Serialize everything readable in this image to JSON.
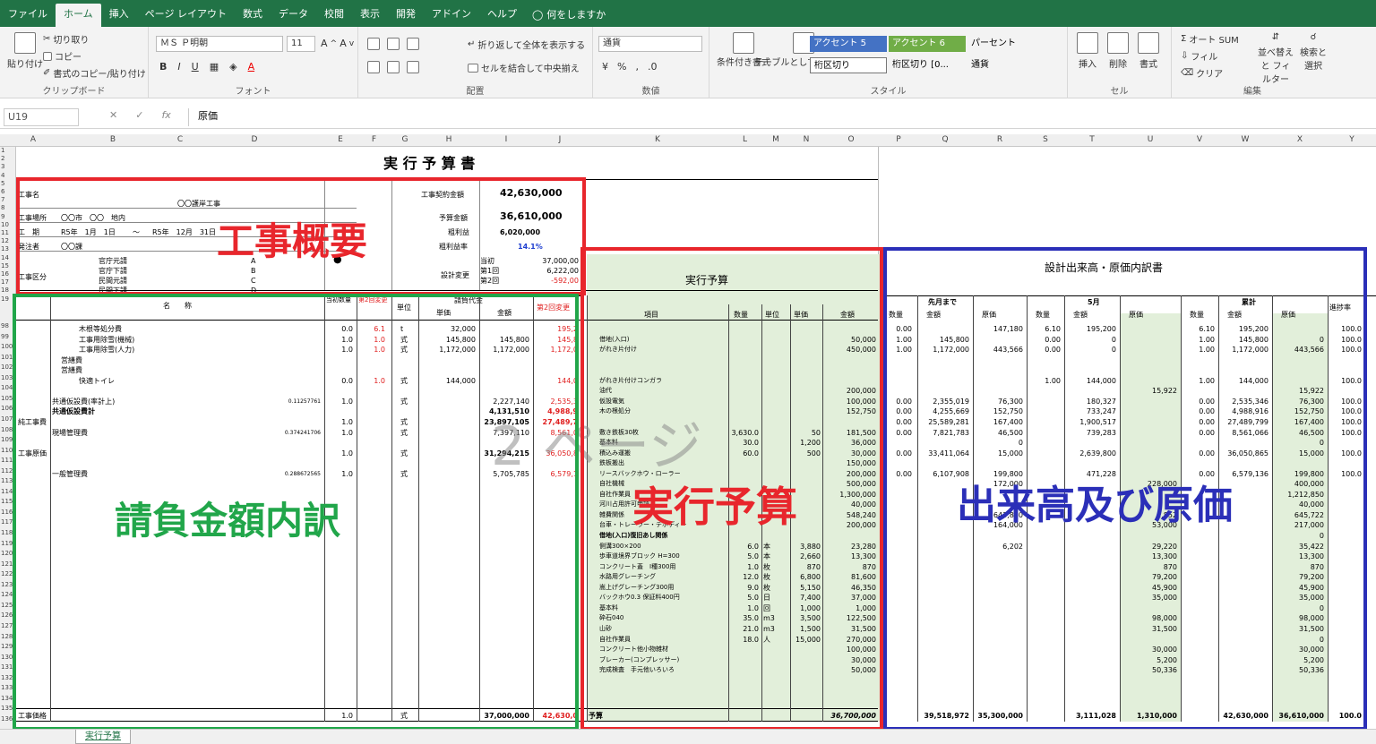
{
  "menu": {
    "file": "ファイル",
    "home": "ホーム",
    "insert": "挿入",
    "page_layout": "ページ レイアウト",
    "formulas": "数式",
    "data": "データ",
    "review": "校閲",
    "view": "表示",
    "developer": "開発",
    "addins": "アドイン",
    "help": "ヘルプ",
    "tell_me": "何をしますか"
  },
  "ribbon": {
    "paste": "貼り付け",
    "cut": "切り取り",
    "copy": "コピー",
    "format_painter": "書式のコピー/貼り付け",
    "clipboard": "クリップボード",
    "font_name": "ＭＳ Ｐ明朝",
    "font_size": "11",
    "font": "フォント",
    "wrap_text": "折り返して全体を表示する",
    "merge_center": "セルを結合して中央揃え",
    "alignment": "配置",
    "number_format": "通貨",
    "number": "数値",
    "conditional": "条件付き書式",
    "table_format": "テーブルとして書式設定",
    "accent5": "アクセント 5",
    "accent6": "アクセント 6",
    "percent": "パーセント",
    "style_sep": "桁区切り",
    "style_sep0": "桁区切り [0...",
    "style_currency": "通貨",
    "styles": "スタイル",
    "insert": "挿入",
    "delete": "削除",
    "format": "書式",
    "cells": "セル",
    "autosum": "オート SUM",
    "fill": "フィル",
    "clear": "クリア",
    "sort_filter": "並べ替えと フィルター",
    "find_select": "検索と 選択",
    "editing": "編集"
  },
  "formula_bar": {
    "cell_ref": "U19",
    "value": "原価",
    "fx": "fx"
  },
  "columns": [
    "A",
    "B",
    "C",
    "D",
    "E",
    "F",
    "G",
    "H",
    "I",
    "J",
    "K",
    "L",
    "M",
    "N",
    "O",
    "P",
    "Q",
    "R",
    "S",
    "T",
    "U",
    "V",
    "W",
    "X",
    "Y"
  ],
  "rows": [
    "1",
    "2",
    "3",
    "4",
    "5",
    "6",
    "7",
    "8",
    "9",
    "10",
    "11",
    "12",
    "13",
    "14",
    "15",
    "16",
    "17",
    "18",
    "19",
    "98",
    "99",
    "100",
    "101",
    "102",
    "103",
    "104",
    "105",
    "106",
    "107",
    "108",
    "109",
    "110",
    "111",
    "112",
    "113",
    "114",
    "115",
    "116",
    "117",
    "118",
    "119",
    "120",
    "121",
    "122",
    "123",
    "124",
    "125",
    "126",
    "127",
    "128",
    "129",
    "130",
    "131",
    "132",
    "133",
    "134",
    "135",
    "136"
  ],
  "sheet": {
    "title": "実 行 予 算 書",
    "summary": {
      "name_label": "工事名",
      "name": "〇〇護岸工事",
      "place_label": "工事場所",
      "place": "〇〇市　〇〇　地内",
      "period_label": "工　期",
      "period_start": "R5年　1月　1日",
      "period_tilde": "〜",
      "period_end": "R5年　12月　31日",
      "orderer_label": "発注者",
      "orderer": "〇〇課",
      "class_label": "工事区分",
      "class_items": [
        "官庁元請",
        "官庁下請",
        "民間元請",
        "民間下請"
      ],
      "class_codes": [
        "A",
        "B",
        "C",
        "D"
      ],
      "contract_label": "工事契約金額",
      "contract": "42,630,000",
      "budget_label": "予算金額",
      "budget": "36,610,000",
      "profit_label": "粗利益",
      "profit": "6,020,000",
      "profit_rate_label": "粗利益率",
      "profit_rate": "14.1%",
      "design_change_label": "設計変更",
      "changes": [
        {
          "label": "当初",
          "value": "37,000,00"
        },
        {
          "label": "第1回",
          "value": "6,222,00"
        },
        {
          "label": "第2回",
          "value": "-592,00"
        }
      ]
    },
    "contract_header": {
      "name": "名　　称",
      "qty": "当初数量",
      "change2": "第2回変更",
      "unit": "単位",
      "contract_price": "請負代金",
      "unit_price": "単価",
      "amount": "金額",
      "change2_amount": "第2回変更"
    },
    "contract_rows": [
      {
        "name": "木根等処分費",
        "qty": "0.0",
        "c2": "6.1",
        "unit": "t",
        "price": "32,000",
        "amount": "",
        "c2amt": "195,2"
      },
      {
        "name": "工事用除雪(機械)",
        "qty": "1.0",
        "c2": "1.0",
        "unit": "式",
        "price": "145,800",
        "amount": "145,800",
        "c2amt": "145,8"
      },
      {
        "name": "工事用除雪(人力)",
        "qty": "1.0",
        "c2": "1.0",
        "unit": "式",
        "price": "1,172,000",
        "amount": "1,172,000",
        "c2amt": "1,172,0"
      },
      {
        "name": "営繕費",
        "qty": "",
        "c2": "",
        "unit": "",
        "price": "",
        "amount": "",
        "c2amt": ""
      },
      {
        "name": "営繕費",
        "qty": "",
        "c2": "",
        "unit": "",
        "price": "",
        "amount": "",
        "c2amt": ""
      },
      {
        "name": "快適トイレ",
        "qty": "0.0",
        "c2": "1.0",
        "unit": "式",
        "price": "144,000",
        "amount": "",
        "c2amt": "144,0"
      },
      {
        "name": "",
        "qty": "",
        "c2": "",
        "unit": "",
        "price": "",
        "amount": "",
        "c2amt": ""
      },
      {
        "name": "共通仮設費(率計上)",
        "rate": "0.11257761",
        "qty": "1.0",
        "c2": "",
        "unit": "式",
        "price": "",
        "amount": "2,227,140",
        "c2amt": "2,535,3"
      },
      {
        "name": "共通仮設費計",
        "qty": "",
        "c2": "",
        "unit": "",
        "price": "",
        "amount": "4,131,510",
        "c2amt": "4,988,9"
      },
      {
        "name": "純工事費",
        "qty": "1.0",
        "c2": "",
        "unit": "式",
        "price": "",
        "amount": "23,897,105",
        "c2amt": "27,489,7"
      },
      {
        "name": "現場管理費",
        "rate": "0.374241706",
        "qty": "1.0",
        "c2": "",
        "unit": "式",
        "price": "",
        "amount": "7,397,110",
        "c2amt": "8,561,0"
      },
      {
        "name": "",
        "qty": "",
        "c2": "",
        "unit": "",
        "price": "",
        "amount": "",
        "c2amt": ""
      },
      {
        "name": "工事原価",
        "qty": "1.0",
        "c2": "",
        "unit": "式",
        "price": "",
        "amount": "31,294,215",
        "c2amt": "36,050,8"
      },
      {
        "name": "",
        "qty": "",
        "c2": "",
        "unit": "",
        "price": "",
        "amount": "",
        "c2amt": ""
      },
      {
        "name": "一般管理費",
        "rate": "0.288672565",
        "qty": "1.0",
        "c2": "",
        "unit": "式",
        "price": "",
        "amount": "5,705,785",
        "c2amt": "6,579,1"
      }
    ],
    "contract_total": {
      "name": "工事価格",
      "qty": "1.0",
      "unit": "式",
      "amount": "37,000,000",
      "c2amt": "42,630,0"
    },
    "budget_header": {
      "title": "実行予算",
      "item": "項目",
      "qty": "数量",
      "unit": "単位",
      "price": "単価",
      "amount": "金額"
    },
    "budget_rows": [
      {
        "item": "",
        "qty": "",
        "unit": "",
        "price": "",
        "amount": ""
      },
      {
        "item": "借地(入口)",
        "qty": "",
        "unit": "",
        "price": "",
        "amount": "50,000"
      },
      {
        "item": "がれき片付け",
        "qty": "",
        "unit": "",
        "price": "",
        "amount": "450,000"
      },
      {
        "item": "",
        "qty": "",
        "unit": "",
        "price": "",
        "amount": ""
      },
      {
        "item": "",
        "qty": "",
        "unit": "",
        "price": "",
        "amount": ""
      },
      {
        "item": "がれき片付けコンガラ",
        "qty": "",
        "unit": "",
        "price": "",
        "amount": ""
      },
      {
        "item": "油代",
        "qty": "",
        "unit": "",
        "price": "",
        "amount": "200,000"
      },
      {
        "item": "仮設電気",
        "qty": "",
        "unit": "",
        "price": "",
        "amount": "100,000"
      },
      {
        "item": "木の根処分",
        "qty": "",
        "unit": "",
        "price": "",
        "amount": "152,750"
      },
      {
        "item": "",
        "qty": "",
        "unit": "",
        "price": "",
        "amount": ""
      },
      {
        "item": "敷き鉄板30枚",
        "qty": "3,630.0",
        "unit": "",
        "price": "50",
        "amount": "181,500"
      },
      {
        "item": "基本料",
        "qty": "30.0",
        "unit": "",
        "price": "1,200",
        "amount": "36,000"
      },
      {
        "item": "積込み運搬",
        "qty": "60.0",
        "unit": "",
        "price": "500",
        "amount": "30,000"
      },
      {
        "item": "鉄板搬出",
        "qty": "",
        "unit": "",
        "price": "",
        "amount": "150,000"
      },
      {
        "item": "リースバックホウ・ローラー",
        "qty": "",
        "unit": "",
        "price": "",
        "amount": "200,000"
      },
      {
        "item": "自社機械",
        "qty": "",
        "unit": "",
        "price": "",
        "amount": "500,000"
      },
      {
        "item": "自社作業員",
        "qty": "",
        "unit": "",
        "price": "",
        "amount": "1,300,000"
      },
      {
        "item": "河川占用許可申請",
        "qty": "",
        "unit": "",
        "price": "",
        "amount": "40,000"
      },
      {
        "item": "雑費関係",
        "qty": "",
        "unit": "",
        "price": "",
        "amount": "548,240"
      },
      {
        "item": "台車・トレーラー・デボディー",
        "qty": "",
        "unit": "",
        "price": "",
        "amount": "200,000"
      },
      {
        "item": "借地(入口)復旧あし関係",
        "qty": "",
        "unit": "",
        "price": "",
        "amount": ""
      },
      {
        "item": "側溝300×200",
        "qty": "6.0",
        "unit": "本",
        "price": "3,880",
        "amount": "23,280"
      },
      {
        "item": "歩車道境界ブロック H=300",
        "qty": "5.0",
        "unit": "本",
        "price": "2,660",
        "amount": "13,300"
      },
      {
        "item": "コンクリート蓋　Ⅰ種300用",
        "qty": "1.0",
        "unit": "枚",
        "price": "870",
        "amount": "870"
      },
      {
        "item": "水路用グレーチング",
        "qty": "12.0",
        "unit": "枚",
        "price": "6,800",
        "amount": "81,600"
      },
      {
        "item": "嵩上げグレーチング300用",
        "qty": "9.0",
        "unit": "枚",
        "price": "5,150",
        "amount": "46,350"
      },
      {
        "item": "バックホウ0.3 保証料400円",
        "qty": "5.0",
        "unit": "日",
        "price": "7,400",
        "amount": "37,000"
      },
      {
        "item": "基本料",
        "qty": "1.0",
        "unit": "回",
        "price": "1,000",
        "amount": "1,000"
      },
      {
        "item": "砕石040",
        "qty": "35.0",
        "unit": "m3",
        "price": "3,500",
        "amount": "122,500"
      },
      {
        "item": "山砂",
        "qty": "21.0",
        "unit": "m3",
        "price": "1,500",
        "amount": "31,500"
      },
      {
        "item": "自社作業員",
        "qty": "18.0",
        "unit": "人",
        "price": "15,000",
        "amount": "270,000"
      },
      {
        "item": "コンクリート他小物雑材",
        "qty": "",
        "unit": "",
        "price": "",
        "amount": "100,000"
      },
      {
        "item": "ブレーカー(コンプレッサー)",
        "qty": "",
        "unit": "",
        "price": "",
        "amount": "30,000"
      },
      {
        "item": "完成検査　手元他いろいろ",
        "qty": "",
        "unit": "",
        "price": "",
        "amount": "50,000"
      }
    ],
    "budget_total": {
      "item": "予算",
      "amount": "36,700,000"
    },
    "progress_header": {
      "title": "設計出来高・原価内訳書",
      "prev": "先月まで",
      "may": "5月",
      "cum": "累計",
      "qty": "数量",
      "amount": "金額",
      "cost": "原価",
      "rate": "進捗率"
    },
    "progress_rows": [
      {
        "pq": "0.00",
        "pa": "",
        "pc": "147,180",
        "mq": "6.10",
        "ma": "195,200",
        "mc": "",
        "cq": "6.10",
        "ca": "195,200",
        "cc": "",
        "rt": "100.0"
      },
      {
        "pq": "1.00",
        "pa": "145,800",
        "pc": "",
        "mq": "0.00",
        "ma": "0",
        "mc": "",
        "cq": "1.00",
        "ca": "145,800",
        "cc": "0",
        "rt": "100.0"
      },
      {
        "pq": "1.00",
        "pa": "1,172,000",
        "pc": "443,566",
        "mq": "0.00",
        "ma": "0",
        "mc": "",
        "cq": "1.00",
        "ca": "1,172,000",
        "cc": "443,566",
        "rt": "100.0"
      },
      {
        "pq": "",
        "pa": "",
        "pc": "",
        "mq": "",
        "ma": "",
        "mc": "",
        "cq": "",
        "ca": "",
        "cc": "",
        "rt": ""
      },
      {
        "pq": "",
        "pa": "",
        "pc": "",
        "mq": "",
        "ma": "",
        "mc": "",
        "cq": "",
        "ca": "",
        "cc": "",
        "rt": ""
      },
      {
        "pq": "",
        "pa": "",
        "pc": "",
        "mq": "1.00",
        "ma": "144,000",
        "mc": "",
        "cq": "1.00",
        "ca": "144,000",
        "cc": "",
        "rt": "100.0"
      },
      {
        "pq": "",
        "pa": "",
        "pc": "",
        "mq": "",
        "ma": "",
        "mc": "15,922",
        "cq": "",
        "ca": "",
        "cc": "15,922",
        "rt": ""
      },
      {
        "pq": "0.00",
        "pa": "2,355,019",
        "pc": "76,300",
        "mq": "",
        "ma": "180,327",
        "mc": "",
        "cq": "0.00",
        "ca": "2,535,346",
        "cc": "76,300",
        "rt": "100.0"
      },
      {
        "pq": "0.00",
        "pa": "4,255,669",
        "pc": "152,750",
        "mq": "",
        "ma": "733,247",
        "mc": "",
        "cq": "0.00",
        "ca": "4,988,916",
        "cc": "152,750",
        "rt": "100.0"
      },
      {
        "pq": "0.00",
        "pa": "25,589,281",
        "pc": "167,400",
        "mq": "",
        "ma": "1,900,517",
        "mc": "",
        "cq": "0.00",
        "ca": "27,489,799",
        "cc": "167,400",
        "rt": "100.0"
      },
      {
        "pq": "0.00",
        "pa": "7,821,783",
        "pc": "46,500",
        "mq": "",
        "ma": "739,283",
        "mc": "",
        "cq": "0.00",
        "ca": "8,561,066",
        "cc": "46,500",
        "rt": "100.0"
      },
      {
        "pq": "",
        "pa": "",
        "pc": "0",
        "mq": "",
        "ma": "",
        "mc": "",
        "cq": "",
        "ca": "",
        "cc": "0",
        "rt": ""
      },
      {
        "pq": "0.00",
        "pa": "33,411,064",
        "pc": "15,000",
        "mq": "",
        "ma": "2,639,800",
        "mc": "",
        "cq": "0.00",
        "ca": "36,050,865",
        "cc": "15,000",
        "rt": "100.0"
      },
      {
        "pq": "",
        "pa": "",
        "pc": "",
        "mq": "",
        "ma": "",
        "mc": "",
        "cq": "",
        "ca": "",
        "cc": "",
        "rt": ""
      },
      {
        "pq": "0.00",
        "pa": "6,107,908",
        "pc": "199,800",
        "mq": "",
        "ma": "471,228",
        "mc": "",
        "cq": "0.00",
        "ca": "6,579,136",
        "cc": "199,800",
        "rt": "100.0"
      },
      {
        "pq": "",
        "pa": "",
        "pc": "172,000",
        "mq": "",
        "ma": "",
        "mc": "228,000",
        "cq": "",
        "ca": "",
        "cc": "400,000",
        "rt": ""
      },
      {
        "pq": "",
        "pa": "",
        "pc": "",
        "mq": "",
        "ma": "",
        "mc": "",
        "cq": "",
        "ca": "",
        "cc": "1,212,850",
        "rt": ""
      },
      {
        "pq": "",
        "pa": "",
        "pc": "",
        "mq": "",
        "ma": "",
        "mc": "",
        "cq": "",
        "ca": "",
        "cc": "40,000",
        "rt": ""
      },
      {
        "pq": "",
        "pa": "",
        "pc": "643,870",
        "mq": "",
        "ma": "",
        "mc": "1,852",
        "cq": "",
        "ca": "",
        "cc": "645,722",
        "rt": ""
      },
      {
        "pq": "",
        "pa": "",
        "pc": "164,000",
        "mq": "",
        "ma": "",
        "mc": "53,000",
        "cq": "",
        "ca": "",
        "cc": "217,000",
        "rt": ""
      },
      {
        "pq": "",
        "pa": "",
        "pc": "",
        "mq": "",
        "ma": "",
        "mc": "",
        "cq": "",
        "ca": "",
        "cc": "0",
        "rt": ""
      },
      {
        "pq": "",
        "pa": "",
        "pc": "6,202",
        "mq": "",
        "ma": "",
        "mc": "29,220",
        "cq": "",
        "ca": "",
        "cc": "35,422",
        "rt": ""
      },
      {
        "pq": "",
        "pa": "",
        "pc": "",
        "mq": "",
        "ma": "",
        "mc": "13,300",
        "cq": "",
        "ca": "",
        "cc": "13,300",
        "rt": ""
      },
      {
        "pq": "",
        "pa": "",
        "pc": "",
        "mq": "",
        "ma": "",
        "mc": "870",
        "cq": "",
        "ca": "",
        "cc": "870",
        "rt": ""
      },
      {
        "pq": "",
        "pa": "",
        "pc": "",
        "mq": "",
        "ma": "",
        "mc": "79,200",
        "cq": "",
        "ca": "",
        "cc": "79,200",
        "rt": ""
      },
      {
        "pq": "",
        "pa": "",
        "pc": "",
        "mq": "",
        "ma": "",
        "mc": "45,900",
        "cq": "",
        "ca": "",
        "cc": "45,900",
        "rt": ""
      },
      {
        "pq": "",
        "pa": "",
        "pc": "",
        "mq": "",
        "ma": "",
        "mc": "35,000",
        "cq": "",
        "ca": "",
        "cc": "35,000",
        "rt": ""
      },
      {
        "pq": "",
        "pa": "",
        "pc": "",
        "mq": "",
        "ma": "",
        "mc": "",
        "cq": "",
        "ca": "",
        "cc": "0",
        "rt": ""
      },
      {
        "pq": "",
        "pa": "",
        "pc": "",
        "mq": "",
        "ma": "",
        "mc": "98,000",
        "cq": "",
        "ca": "",
        "cc": "98,000",
        "rt": ""
      },
      {
        "pq": "",
        "pa": "",
        "pc": "",
        "mq": "",
        "ma": "",
        "mc": "31,500",
        "cq": "",
        "ca": "",
        "cc": "31,500",
        "rt": ""
      },
      {
        "pq": "",
        "pa": "",
        "pc": "",
        "mq": "",
        "ma": "",
        "mc": "",
        "cq": "",
        "ca": "",
        "cc": "0",
        "rt": ""
      },
      {
        "pq": "",
        "pa": "",
        "pc": "",
        "mq": "",
        "ma": "",
        "mc": "30,000",
        "cq": "",
        "ca": "",
        "cc": "30,000",
        "rt": ""
      },
      {
        "pq": "",
        "pa": "",
        "pc": "",
        "mq": "",
        "ma": "",
        "mc": "5,200",
        "cq": "",
        "ca": "",
        "cc": "5,200",
        "rt": ""
      },
      {
        "pq": "",
        "pa": "",
        "pc": "",
        "mq": "",
        "ma": "",
        "mc": "50,336",
        "cq": "",
        "ca": "",
        "cc": "50,336",
        "rt": ""
      }
    ],
    "progress_total": {
      "pa": "39,518,972",
      "pc": "35,300,000",
      "ma": "3,111,028",
      "mc": "1,310,000",
      "ca": "42,630,000",
      "cc": "36,610,000",
      "rt": "100.0"
    },
    "watermark": "2 ページ"
  },
  "overlays": {
    "summary": "工事概要",
    "contract": "請負金額内訳",
    "budget": "実行予算",
    "progress": "出来高及び原価"
  },
  "colors": {
    "red": "#e8262c",
    "green": "#21a64a",
    "blue": "#2b2fb8",
    "excel_green": "#217346",
    "cell_green": "#e2efda"
  },
  "tabs": {
    "active": "実行予算"
  }
}
